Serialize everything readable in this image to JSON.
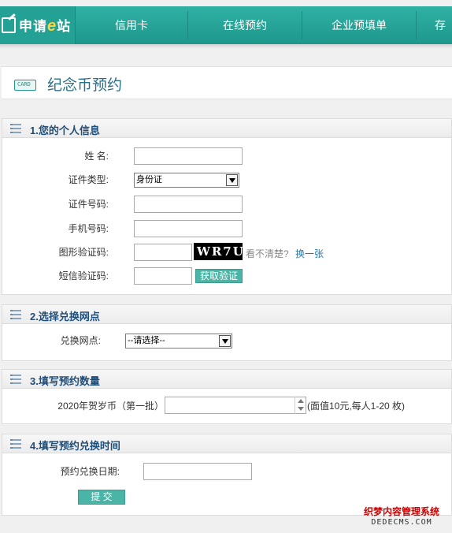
{
  "nav": {
    "logo_text": "申请",
    "logo_e": "e",
    "logo_text2": "站",
    "items": [
      "信用卡",
      "在线预约",
      "企业预填单",
      "存"
    ]
  },
  "page": {
    "icon_text": "CARD",
    "title": "纪念币预约"
  },
  "section1": {
    "title": "1.您的个人信息",
    "name_label": "姓 名:",
    "id_type_label": "证件类型:",
    "id_type_value": "身份证",
    "id_number_label": "证件号码:",
    "phone_label": "手机号码:",
    "captcha_label": "图形验证码:",
    "captcha_text": "WR7U",
    "captcha_hint": "看不清楚?",
    "captcha_refresh": "换一张",
    "sms_label": "短信验证码:",
    "sms_button": "获取验证码"
  },
  "section2": {
    "title": "2.选择兑换网点",
    "branch_label": "兑换网点:",
    "branch_value": "--请选择--"
  },
  "section3": {
    "title": "3.填写预约数量",
    "coin_label": "2020年贺岁币（第一批）",
    "coin_hint": "(面值10元,每人1-20 枚)"
  },
  "section4": {
    "title": "4.填写预约兑换时间",
    "date_label": "预约兑换日期:",
    "submit": "提 交"
  },
  "watermark": {
    "line1": "织梦内容管理系统",
    "line2": "DEDECMS.COM"
  },
  "colors": {
    "nav": "#23a194",
    "button": "#4ab4a6",
    "section_title": "#1f4e79",
    "link": "#1e7bb8"
  }
}
